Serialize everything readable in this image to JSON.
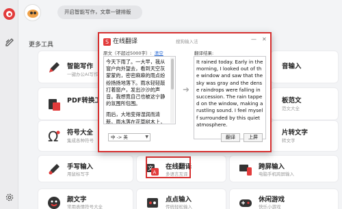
{
  "app": {
    "promo_text": "开启智能写作，文章一键排版"
  },
  "section": {
    "title": "更多工具"
  },
  "colors": {
    "accent": "#d62f2f",
    "brand": "#e23b3b"
  },
  "tools": [
    {
      "name": "智能写作",
      "desc": "一键办公AI写作",
      "icon": "pen-icon"
    },
    {
      "name": "PDF转换工",
      "desc": "",
      "icon": "pdf-icon"
    },
    {
      "name": "符号大全",
      "desc": "集成各种符号",
      "icon": "omega-icon"
    },
    {
      "name": "手写输入",
      "desc": "用鼠标写字",
      "icon": "handwrite-icon"
    },
    {
      "name": "在线翻译",
      "desc": "多语言互译",
      "icon": "translate-icon"
    },
    {
      "name": "跨屏输入",
      "desc": "电脑手机跨屏输入",
      "icon": "crossscreen-icon"
    },
    {
      "name": "颜文字",
      "desc": "常用表情符号大全",
      "icon": "emoticon-icon"
    },
    {
      "name": "点点输入",
      "desc": "传统轻松输入",
      "icon": "dot-input-icon"
    },
    {
      "name": "休闲游戏",
      "desc": "快乐小游戏",
      "icon": "game-icon"
    }
  ],
  "right_tools": [
    {
      "name": "音输入",
      "desc": ""
    },
    {
      "name": "板范文",
      "desc": "范文大全"
    },
    {
      "name": "片转文字",
      "desc": "转文字"
    }
  ],
  "dialog": {
    "title": "在线翻译",
    "title_icon": "S",
    "hint": "搜狗输入法",
    "min": "—",
    "close": "✕",
    "src_label": "原文（不超过5000字）:",
    "clear": "清空",
    "dst_label": "翻译结果:",
    "src_p1": "今天下雨了。一大早，我从窗户向外望去，看到天空灰蒙蒙的，密密麻麻的雨点纷纷扬扬地落下。雨水轻轻敲打着窗户，发出沙沙的声音。我想竟自己也被这宁静的氛围所包围。",
    "src_p2": "雨后，大地变得湿润而清新。雨水落在花草树木上，像一颗颗晶莹的珍珠，为大自然增添",
    "dst": "It rained today. Early in the morning, I looked out of the window and saw that the sky was gray and the dense raindrops were falling in succession. The rain tapped on the window, making a rustling sound. I feel myself surrounded by this quiet atmosphere.",
    "lang": "中 -> 英",
    "translate_btn": "翻译",
    "submit_btn": "上屏",
    "arrow": "➜"
  }
}
